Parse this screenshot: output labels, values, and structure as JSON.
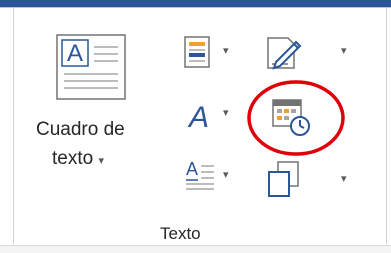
{
  "ribbon": {
    "group_label": "Texto",
    "text_box": {
      "label_line1": "Cuadro de",
      "label_line2": "texto",
      "dropdown_glyph": "▾",
      "icon": "text-box-icon",
      "icon_glyph": "A"
    },
    "buttons": [
      {
        "name": "quick-parts",
        "icon": "quick-parts-icon",
        "has_dropdown": true
      },
      {
        "name": "signature-line",
        "icon": "signature-line-icon",
        "has_dropdown": true
      },
      {
        "name": "wordart",
        "icon": "wordart-icon",
        "has_dropdown": true
      },
      {
        "name": "date-and-time",
        "icon": "date-time-icon",
        "has_dropdown": false,
        "highlighted": true
      },
      {
        "name": "drop-cap",
        "icon": "drop-cap-icon",
        "has_dropdown": true
      },
      {
        "name": "insert-object",
        "icon": "object-icon",
        "has_dropdown": true
      }
    ],
    "wordart_glyph": "A",
    "drop_cap_glyph": "A",
    "dropdown_glyph": "▾",
    "highlight_color": "#e0000a",
    "accent_color": "#2b579a"
  }
}
